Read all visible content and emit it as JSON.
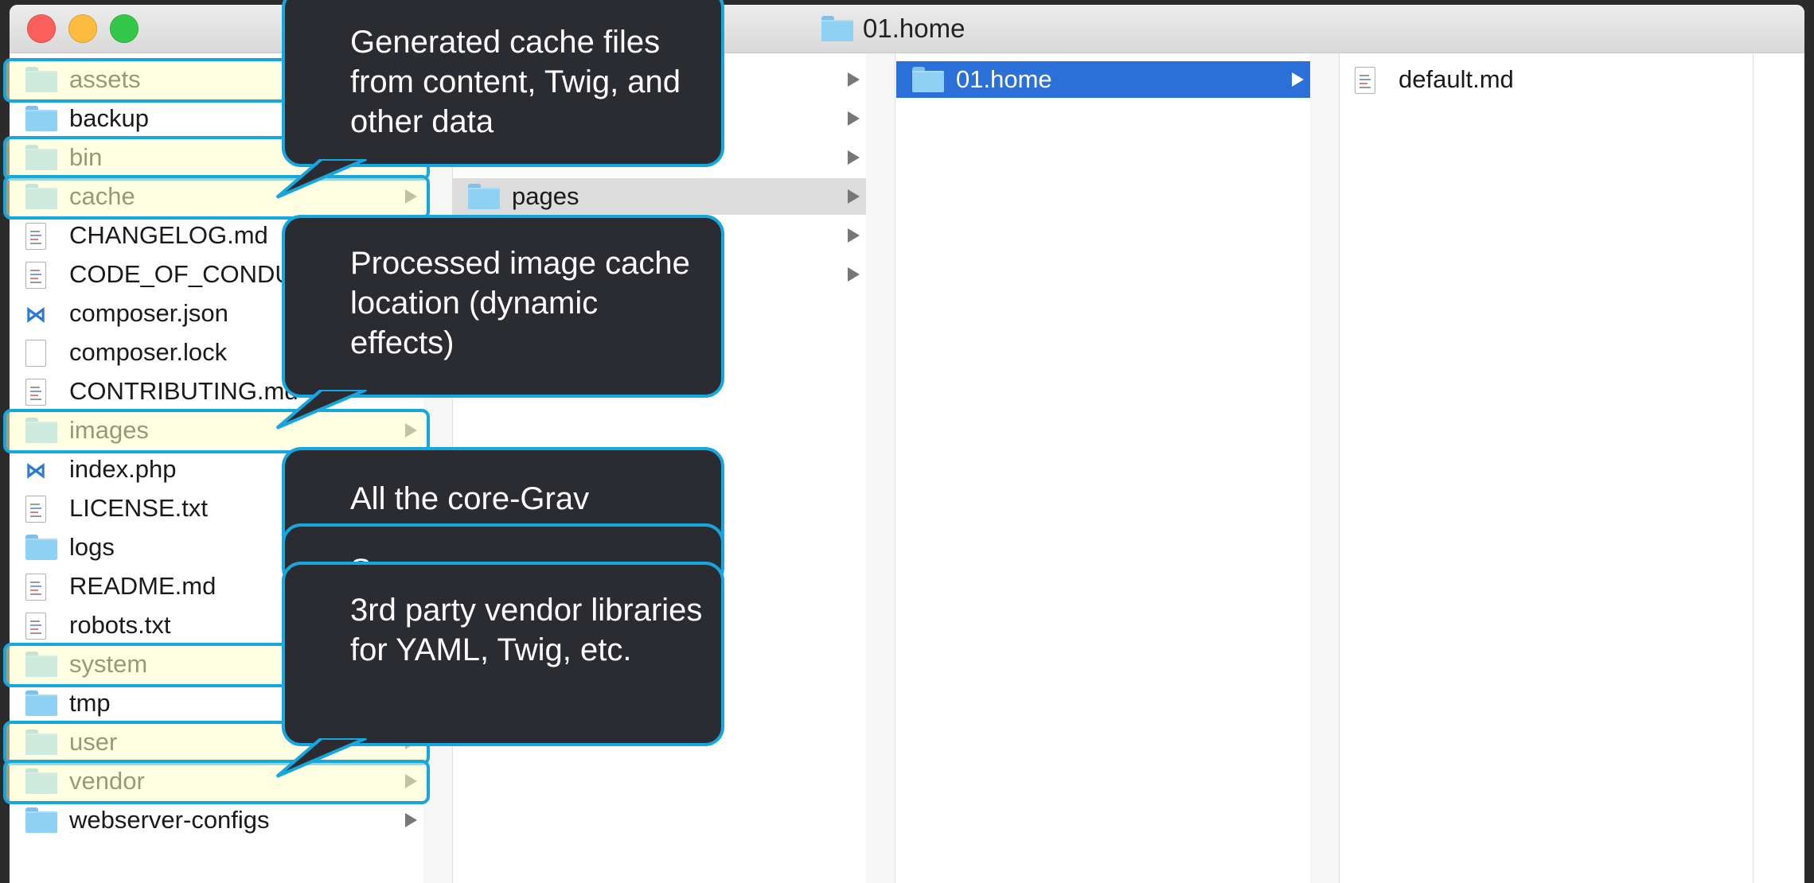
{
  "window": {
    "title": "01.home"
  },
  "column1": {
    "items": [
      {
        "label": "assets",
        "type": "folder",
        "arrow": true
      },
      {
        "label": "backup",
        "type": "folder",
        "arrow": true
      },
      {
        "label": "bin",
        "type": "folder",
        "arrow": true
      },
      {
        "label": "cache",
        "type": "folder",
        "arrow": true
      },
      {
        "label": "CHANGELOG.md",
        "type": "doc"
      },
      {
        "label": "CODE_OF_CONDUCT.md",
        "type": "doc"
      },
      {
        "label": "composer.json",
        "type": "vscode"
      },
      {
        "label": "composer.lock",
        "type": "blank"
      },
      {
        "label": "CONTRIBUTING.md",
        "type": "doc"
      },
      {
        "label": "images",
        "type": "folder",
        "arrow": true
      },
      {
        "label": "index.php",
        "type": "vscode"
      },
      {
        "label": "LICENSE.txt",
        "type": "doc"
      },
      {
        "label": "logs",
        "type": "folder",
        "arrow": true
      },
      {
        "label": "README.md",
        "type": "doc"
      },
      {
        "label": "robots.txt",
        "type": "doc"
      },
      {
        "label": "system",
        "type": "folder",
        "arrow": true
      },
      {
        "label": "tmp",
        "type": "folder",
        "arrow": true
      },
      {
        "label": "user",
        "type": "folder",
        "arrow": true
      },
      {
        "label": "vendor",
        "type": "folder",
        "arrow": true
      },
      {
        "label": "webserver-configs",
        "type": "folder",
        "arrow": true
      }
    ]
  },
  "column2": {
    "items": [
      {
        "label": "pages",
        "type": "folder",
        "arrow": true
      }
    ]
  },
  "column3": {
    "items": [
      {
        "label": "01.home",
        "type": "folder",
        "arrow": true,
        "selected": true
      }
    ]
  },
  "column4": {
    "items": [
      {
        "label": "default.md",
        "type": "doc"
      }
    ]
  },
  "callouts": [
    {
      "text": "Generated cache files from content, Twig, and other data"
    },
    {
      "text": "Processed image cache location (dynamic effects)"
    },
    {
      "text": "All the core-Grav"
    },
    {
      "text": "S"
    },
    {
      "text": "3rd party vendor libraries for YAML, Twig, etc."
    }
  ],
  "colors": {
    "highlight_border": "#16a7df",
    "callout_bg": "#2a2c31",
    "selection": "#2b6fd8"
  }
}
